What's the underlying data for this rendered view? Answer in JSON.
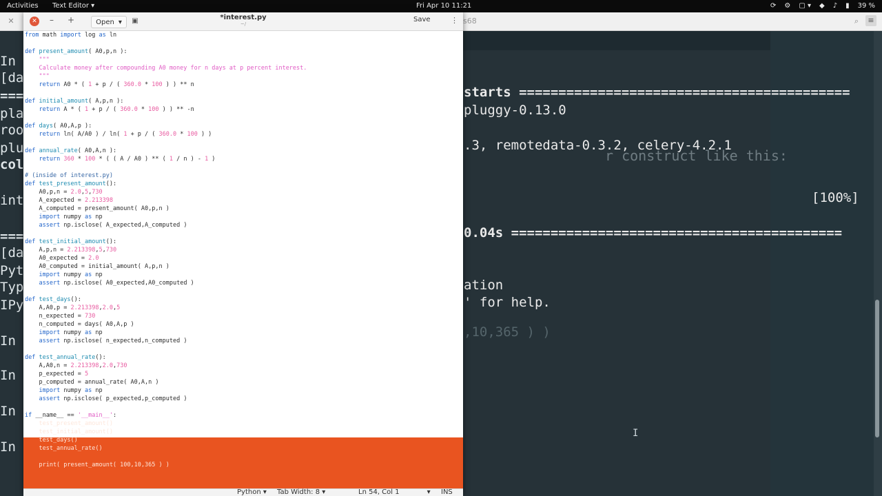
{
  "topbar": {
    "activities": "Activities",
    "app_menu": "Text Editor ▾",
    "clock": "Fri Apr 10  11:21",
    "battery": "39 %"
  },
  "terminal": {
    "title": "s68",
    "left_fragments": [
      "In",
      "[da",
      "===",
      "pla",
      "roo",
      "plu",
      "col",
      "int",
      "===",
      "[da",
      "Pyt",
      "Typ",
      "IPy",
      "In",
      "In",
      "In",
      "In"
    ],
    "right_lines": [
      "starts ==========================================",
      "pluggy-0.13.0",
      ".3, remotedata-0.3.2, celery-4.2.1",
      "[100%]",
      "0.04s ==========================================",
      "ation",
      "' for help.",
      ",10,365 ) )"
    ],
    "ghost_text": "r construct like this:"
  },
  "editor": {
    "title": "*interest.py",
    "subtitle": "~/",
    "open_label": "Open",
    "save_label": "Save",
    "code": [
      "from math import log as ln",
      "",
      "def present_amount( A0,p,n ):",
      "    \"\"\"",
      "    Calculate money after compounding A0 money for n days at p percent interest.",
      "    \"\"\"",
      "    return A0 * ( 1 + p / ( 360.0 * 100 ) ) ** n",
      "",
      "def initial_amount( A,p,n ):",
      "    return A * ( 1 + p / ( 360.0 * 100 ) ) ** -n",
      "",
      "def days( A0,A,p ):",
      "    return ln( A/A0 ) / ln( 1 + p / ( 360.0 * 100 ) )",
      "",
      "def annual_rate( A0,A,n ):",
      "    return 360 * 100 * ( ( A / A0 ) ** ( 1 / n ) - 1 )",
      "",
      "# (inside of interest.py)",
      "def test_present_amount():",
      "    A0,p,n = 2.0,5,730",
      "    A_expected = 2.213398",
      "    A_computed = present_amount( A0,p,n )",
      "    import numpy as np",
      "    assert np.isclose( A_expected,A_computed )",
      "",
      "def test_initial_amount():",
      "    A,p,n = 2.213398,5,730",
      "    A0_expected = 2.0",
      "    A0_computed = initial_amount( A,p,n )",
      "    import numpy as np",
      "    assert np.isclose( A0_expected,A0_computed )",
      "",
      "def test_days():",
      "    A,A0,p = 2.213398,2.0,5",
      "    n_expected = 730",
      "    n_computed = days( A0,A,p )",
      "    import numpy as np",
      "    assert np.isclose( n_expected,n_computed )",
      "",
      "def test_annual_rate():",
      "    A,A0,n = 2.213398,2.0,730",
      "    p_expected = 5",
      "    p_computed = annual_rate( A0,A,n )",
      "    import numpy as np",
      "    assert np.isclose( p_expected,p_computed )",
      "",
      "if __name__ == '__main__':",
      "    test_present_amount()",
      "    test_initial_amount()",
      "    test_days()",
      "    test_annual_rate()",
      "",
      "    print( present_amount( 100,10,365 ) )"
    ],
    "status": {
      "language": "Python ▾",
      "tab_width": "Tab Width: 8 ▾",
      "position": "Ln 54, Col 1",
      "position_menu": "▾",
      "mode": "INS"
    }
  },
  "colors": {
    "selection": "#e95420",
    "terminal_bg": "#263238",
    "keyword": "#1f63c9",
    "string": "#e05bc4"
  }
}
